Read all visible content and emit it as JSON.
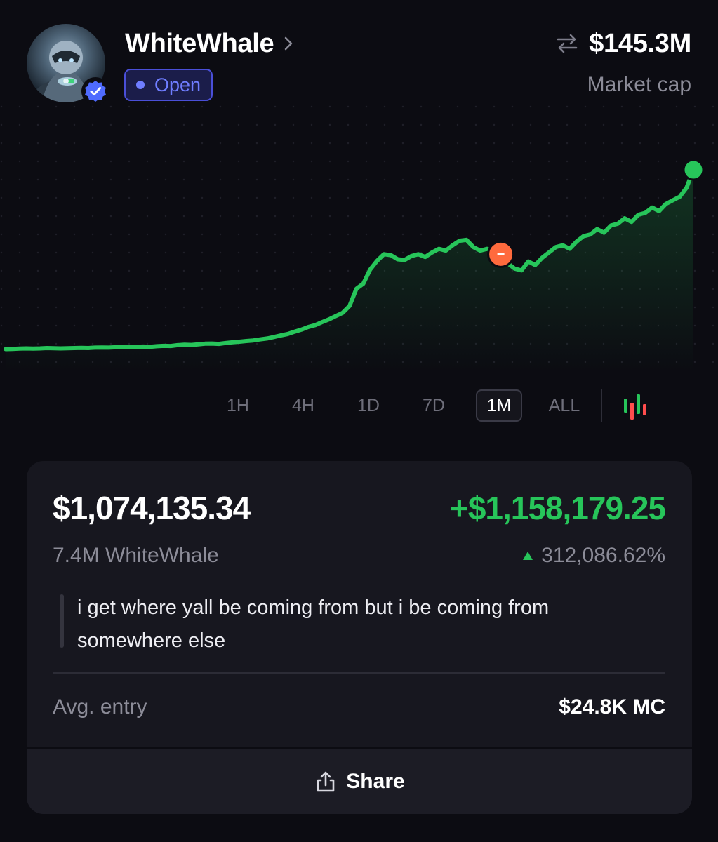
{
  "token": {
    "name": "WhiteWhale",
    "status": "Open",
    "market_cap": "$145.3M",
    "market_cap_label": "Market cap"
  },
  "timeframes": {
    "items": [
      "1H",
      "4H",
      "1D",
      "7D",
      "1M",
      "ALL"
    ],
    "selected": "1M"
  },
  "position": {
    "value": "$1,074,135.34",
    "pnl": "+$1,158,179.25",
    "holdings": "7.4M WhiteWhale",
    "pnl_pct": "312,086.62%",
    "note": "i get where yall be coming from but i be coming from somewhere else",
    "avg_entry_label": "Avg. entry",
    "avg_entry_value": "$24.8K MC"
  },
  "actions": {
    "share_label": "Share"
  },
  "colors": {
    "accent_green": "#27c55a",
    "sell_marker": "#ff6a3d",
    "badge_blue": "#6f7dff",
    "background": "#0c0c12"
  },
  "chart_data": {
    "type": "line",
    "title": "",
    "xlabel": "",
    "ylabel": "",
    "grid": true,
    "x": [
      0,
      1,
      2,
      3,
      4,
      5,
      6,
      7,
      8,
      9,
      10,
      11,
      12,
      13,
      14,
      15,
      16,
      17,
      18,
      19,
      20,
      21,
      22,
      23,
      24,
      25,
      26,
      27,
      28,
      29,
      30,
      31,
      32,
      33,
      34,
      35,
      36,
      37,
      38,
      39,
      40,
      41,
      42,
      43,
      44,
      45,
      46,
      47,
      48,
      49,
      50,
      51,
      52,
      53,
      54,
      55,
      56,
      57,
      58,
      59,
      60,
      61,
      62,
      63,
      64,
      65,
      66,
      67,
      68,
      69,
      70,
      71,
      72,
      73,
      74,
      75,
      76,
      77,
      78,
      79,
      80,
      81,
      82,
      83,
      84,
      85,
      86,
      87,
      88,
      89,
      90,
      91,
      92,
      93,
      94,
      95,
      96,
      97,
      98,
      99,
      100
    ],
    "series": [
      {
        "values": [
          0.2,
          0.3,
          0.5,
          0.6,
          0.5,
          0.6,
          0.8,
          0.7,
          0.6,
          0.7,
          0.8,
          0.9,
          0.8,
          1.0,
          1.1,
          1.0,
          1.2,
          1.3,
          1.2,
          1.5,
          1.6,
          1.5,
          1.8,
          2.0,
          1.9,
          2.4,
          2.6,
          2.5,
          2.8,
          3.2,
          3.3,
          3.1,
          3.6,
          4.0,
          4.3,
          4.7,
          5.0,
          5.6,
          6.1,
          6.9,
          7.8,
          8.6,
          9.9,
          11.0,
          12.5,
          13.5,
          15.2,
          16.7,
          18.6,
          20.4,
          24.2,
          33.8,
          36.6,
          44.5,
          49.3,
          53.0,
          52.5,
          50.2,
          49.8,
          52.0,
          53.0,
          51.5,
          54.0,
          56.0,
          55.0,
          58.0,
          60.5,
          61.0,
          57.0,
          55.0,
          56.0,
          54.0,
          53.0,
          48.0,
          45.0,
          44.0,
          49.0,
          47.0,
          51.0,
          54.0,
          57.0,
          58.0,
          56.0,
          60.0,
          63.0,
          64.0,
          67.0,
          65.0,
          69.0,
          70.0,
          73.0,
          71.0,
          75.0,
          76.0,
          79.0,
          77.0,
          81.0,
          83.0,
          85.0,
          90.0,
          100.0
        ]
      }
    ],
    "markers": [
      {
        "type": "sell",
        "x": 72
      }
    ],
    "ylim": [
      0,
      100
    ],
    "fill_under": true
  }
}
